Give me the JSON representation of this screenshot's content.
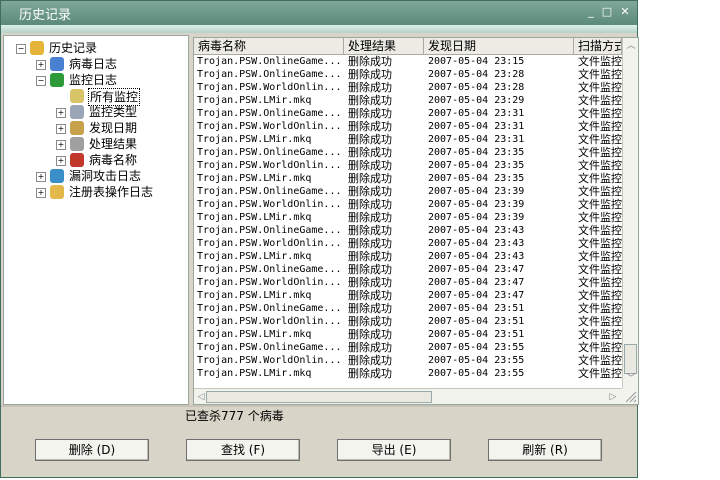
{
  "window": {
    "title": "历史记录",
    "controls": {
      "minimize": "_",
      "maximize": "□",
      "close": "✕"
    }
  },
  "tree": {
    "items": [
      {
        "label": "历史记录",
        "level": 0,
        "expander": "−",
        "icon": "folder-user-icon",
        "color": "#e6b43a"
      },
      {
        "label": "病毒日志",
        "level": 1,
        "expander": "+",
        "icon": "book-icon",
        "color": "#4b7fd1"
      },
      {
        "label": "监控日志",
        "level": 1,
        "expander": "−",
        "icon": "umbrella-icon",
        "color": "#2c9b37"
      },
      {
        "label": "所有监控",
        "level": 2,
        "expander": "",
        "icon": "document-icon",
        "color": "#d9c46a",
        "selected": true
      },
      {
        "label": "监控类型",
        "level": 2,
        "expander": "+",
        "icon": "document-search-icon",
        "color": "#9aa6b8"
      },
      {
        "label": "发现日期",
        "level": 2,
        "expander": "+",
        "icon": "clock-icon",
        "color": "#c8a24a"
      },
      {
        "label": "处理结果",
        "level": 2,
        "expander": "+",
        "icon": "document-check-icon",
        "color": "#a0a0a0"
      },
      {
        "label": "病毒名称",
        "level": 2,
        "expander": "+",
        "icon": "virus-doc-icon",
        "color": "#c0392b"
      },
      {
        "label": "漏洞攻击日志",
        "level": 1,
        "expander": "+",
        "icon": "computer-shield-icon",
        "color": "#3a8fc8"
      },
      {
        "label": "注册表操作日志",
        "level": 1,
        "expander": "+",
        "icon": "registry-icon",
        "color": "#e4b84b"
      }
    ]
  },
  "table": {
    "columns": [
      "病毒名称",
      "处理结果",
      "发现日期",
      "扫描方式"
    ],
    "rows": [
      [
        "Trojan.PSW.OnlineGame...",
        "删除成功",
        "2007-05-04 23:15",
        "文件监控"
      ],
      [
        "Trojan.PSW.OnlineGame...",
        "删除成功",
        "2007-05-04 23:28",
        "文件监控"
      ],
      [
        "Trojan.PSW.WorldOnlin...",
        "删除成功",
        "2007-05-04 23:28",
        "文件监控"
      ],
      [
        "Trojan.PSW.LMir.mkq",
        "删除成功",
        "2007-05-04 23:29",
        "文件监控"
      ],
      [
        "Trojan.PSW.OnlineGame...",
        "删除成功",
        "2007-05-04 23:31",
        "文件监控"
      ],
      [
        "Trojan.PSW.WorldOnlin...",
        "删除成功",
        "2007-05-04 23:31",
        "文件监控"
      ],
      [
        "Trojan.PSW.LMir.mkq",
        "删除成功",
        "2007-05-04 23:31",
        "文件监控"
      ],
      [
        "Trojan.PSW.OnlineGame...",
        "删除成功",
        "2007-05-04 23:35",
        "文件监控"
      ],
      [
        "Trojan.PSW.WorldOnlin...",
        "删除成功",
        "2007-05-04 23:35",
        "文件监控"
      ],
      [
        "Trojan.PSW.LMir.mkq",
        "删除成功",
        "2007-05-04 23:35",
        "文件监控"
      ],
      [
        "Trojan.PSW.OnlineGame...",
        "删除成功",
        "2007-05-04 23:39",
        "文件监控"
      ],
      [
        "Trojan.PSW.WorldOnlin...",
        "删除成功",
        "2007-05-04 23:39",
        "文件监控"
      ],
      [
        "Trojan.PSW.LMir.mkq",
        "删除成功",
        "2007-05-04 23:39",
        "文件监控"
      ],
      [
        "Trojan.PSW.OnlineGame...",
        "删除成功",
        "2007-05-04 23:43",
        "文件监控"
      ],
      [
        "Trojan.PSW.WorldOnlin...",
        "删除成功",
        "2007-05-04 23:43",
        "文件监控"
      ],
      [
        "Trojan.PSW.LMir.mkq",
        "删除成功",
        "2007-05-04 23:43",
        "文件监控"
      ],
      [
        "Trojan.PSW.OnlineGame...",
        "删除成功",
        "2007-05-04 23:47",
        "文件监控"
      ],
      [
        "Trojan.PSW.WorldOnlin...",
        "删除成功",
        "2007-05-04 23:47",
        "文件监控"
      ],
      [
        "Trojan.PSW.LMir.mkq",
        "删除成功",
        "2007-05-04 23:47",
        "文件监控"
      ],
      [
        "Trojan.PSW.OnlineGame...",
        "删除成功",
        "2007-05-04 23:51",
        "文件监控"
      ],
      [
        "Trojan.PSW.WorldOnlin...",
        "删除成功",
        "2007-05-04 23:51",
        "文件监控"
      ],
      [
        "Trojan.PSW.LMir.mkq",
        "删除成功",
        "2007-05-04 23:51",
        "文件监控"
      ],
      [
        "Trojan.PSW.OnlineGame...",
        "删除成功",
        "2007-05-04 23:55",
        "文件监控"
      ],
      [
        "Trojan.PSW.WorldOnlin...",
        "删除成功",
        "2007-05-04 23:55",
        "文件监控"
      ],
      [
        "Trojan.PSW.LMir.mkq",
        "删除成功",
        "2007-05-04 23:55",
        "文件监控"
      ]
    ]
  },
  "status": {
    "text": "已查杀777 个病毒"
  },
  "buttons": {
    "delete": "删除 (D)",
    "find": "查找 (F)",
    "export": "导出 (E)",
    "refresh": "刷新 (R)"
  },
  "colors": {
    "title_bar": "#5b8a79",
    "window_bg": "#d8d5c8"
  }
}
